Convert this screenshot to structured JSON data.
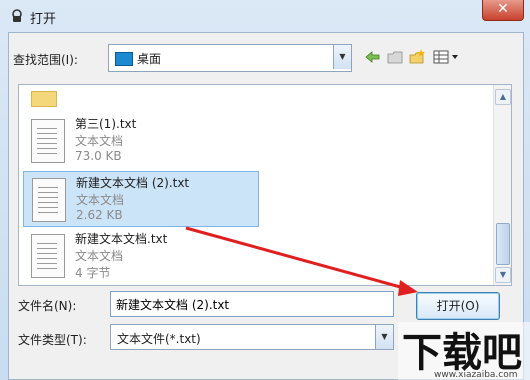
{
  "window": {
    "title": "打开",
    "close_symbol": "✕"
  },
  "toolbar": {
    "look_in_label": "查找范围(I):",
    "look_in_value": "桌面",
    "icons": [
      "back-arrow-icon",
      "up-folder-icon",
      "new-folder-icon",
      "view-menu-icon"
    ]
  },
  "files": [
    {
      "name": "第三(1).txt",
      "type": "文本文档",
      "size": "73.0 KB",
      "selected": false
    },
    {
      "name": "新建文本文档 (2).txt",
      "type": "文本文档",
      "size": "2.62 KB",
      "selected": true
    },
    {
      "name": "新建文本文档.txt",
      "type": "文本文档",
      "size": "4 字节",
      "selected": false
    }
  ],
  "bottom": {
    "filename_label": "文件名(N):",
    "filename_value": "新建文本文档 (2).txt",
    "filetype_label": "文件类型(T):",
    "filetype_value": "文本文件(*.txt)",
    "open_button": "打开(O)"
  },
  "annotation": {
    "arrow_color": "#e02020"
  },
  "watermark": {
    "logo_text": "下载吧",
    "url": "www.xiazaiba.com"
  }
}
